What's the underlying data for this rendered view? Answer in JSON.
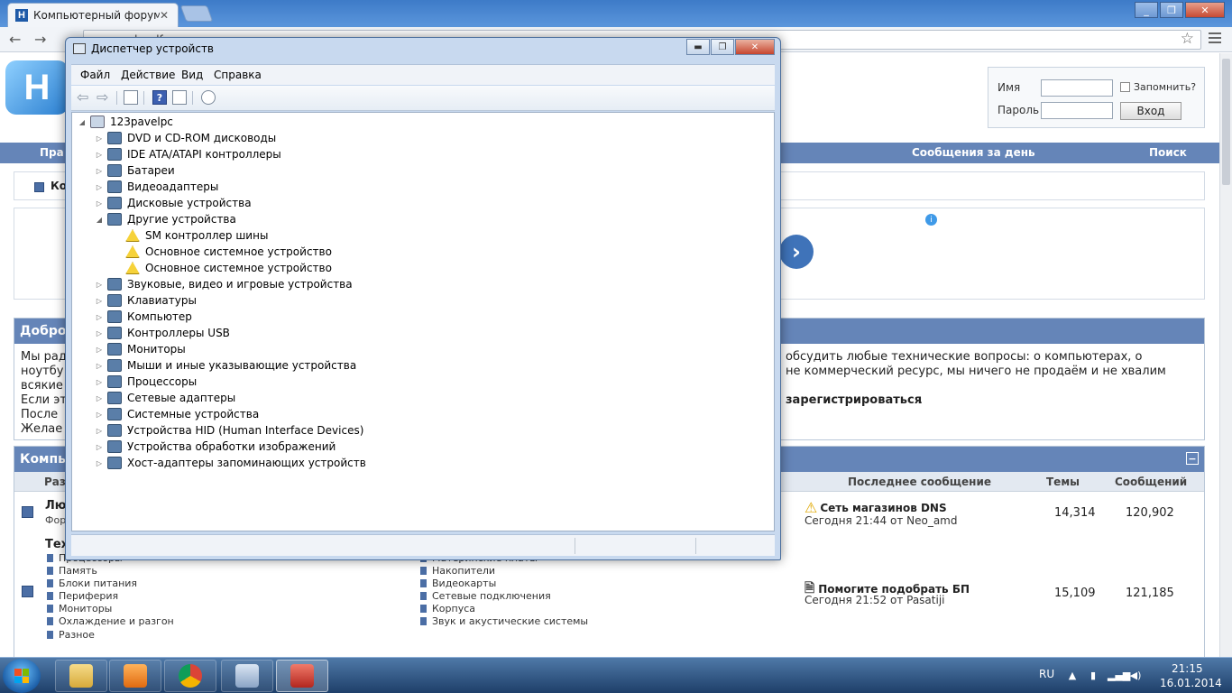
{
  "browser": {
    "tab_title": "Компьютерный форум",
    "tab_close": "✕",
    "favicon_letter": "H",
    "url": "www.hardforum.ru",
    "back_icon": "←",
    "forward_icon": "→",
    "star_icon": "☆",
    "window_buttons": [
      "_",
      "❐",
      "✕"
    ]
  },
  "site": {
    "logo_letter": "H",
    "login": {
      "name_label": "Имя",
      "password_label": "Пароль",
      "remember_label": "Запомнить?",
      "login_button": "Вход"
    },
    "navbar": {
      "left_partial": "Пра",
      "messages_today": "Сообщения за день",
      "search": "Поиск"
    },
    "breadcrumb_partial": "Ко",
    "ad_arrow": "›",
    "ad_info": "i",
    "welcome": {
      "title_partial": "Добро",
      "lines_left": [
        "Мы рад",
        "ноутбу",
        "всякие",
        "Если эт",
        "После",
        "Желае"
      ],
      "line1_right": "обсудить любые технические вопросы: о компьютерах, о",
      "line2_right": "не коммерческий ресурс, мы ничего не продаём и не хвалим",
      "line4_right_bold": "зарегистрироваться",
      "line4_right_end": "."
    },
    "forums": {
      "title_partial": "Компь",
      "collapse": "−",
      "columns": {
        "section_partial": "Раз",
        "last_post": "Последнее сообщение",
        "threads": "Темы",
        "posts": "Сообщений"
      },
      "rows": [
        {
          "title_partial": "Лю",
          "sub_partial": "Фор",
          "last_title": "Сеть магазинов DNS",
          "last_by": "Сегодня 21:44 от Neo_amd",
          "threads": "14,314",
          "posts": "120,902"
        },
        {
          "title_partial": "Тех",
          "last_title": "Помогите подобрать БП",
          "last_by": "Сегодня 21:52 от Pasatiji",
          "threads": "15,109",
          "posts": "121,185",
          "subforums_left": [
            "Процессоры",
            "Память",
            "Блоки питания",
            "Периферия",
            "Мониторы",
            "Охлаждение и разгон",
            "Разное"
          ],
          "subforums_right": [
            "Материнские платы",
            "Накопители",
            "Видеокарты",
            "Сетевые подключения",
            "Корпуса",
            "Звук и акустические системы"
          ]
        }
      ]
    }
  },
  "device_manager": {
    "title": "Диспетчер устройств",
    "window_buttons": [
      "▬",
      "❐",
      "✕"
    ],
    "menu": [
      "Файл",
      "Действие",
      "Вид",
      "Справка"
    ],
    "toolbar": {
      "back": "⇦",
      "forward": "⇨",
      "help": "?"
    },
    "root": "123pavelpc",
    "nodes": [
      {
        "label": "DVD и CD-ROM дисководы",
        "expander": "▷",
        "level": 1
      },
      {
        "label": "IDE ATA/ATAPI контроллеры",
        "expander": "▷",
        "level": 1
      },
      {
        "label": "Батареи",
        "expander": "▷",
        "level": 1
      },
      {
        "label": "Видеоадаптеры",
        "expander": "▷",
        "level": 1
      },
      {
        "label": "Дисковые устройства",
        "expander": "▷",
        "level": 1
      },
      {
        "label": "Другие устройства",
        "expander": "◢",
        "level": 1
      },
      {
        "label": "SM контроллер шины",
        "expander": "",
        "level": 2,
        "warning": true
      },
      {
        "label": "Основное системное устройство",
        "expander": "",
        "level": 2,
        "warning": true
      },
      {
        "label": "Основное системное устройство",
        "expander": "",
        "level": 2,
        "warning": true
      },
      {
        "label": "Звуковые, видео и игровые устройства",
        "expander": "▷",
        "level": 1
      },
      {
        "label": "Клавиатуры",
        "expander": "▷",
        "level": 1
      },
      {
        "label": "Компьютер",
        "expander": "▷",
        "level": 1
      },
      {
        "label": "Контроллеры USB",
        "expander": "▷",
        "level": 1
      },
      {
        "label": "Мониторы",
        "expander": "▷",
        "level": 1
      },
      {
        "label": "Мыши и иные указывающие устройства",
        "expander": "▷",
        "level": 1
      },
      {
        "label": "Процессоры",
        "expander": "▷",
        "level": 1
      },
      {
        "label": "Сетевые адаптеры",
        "expander": "▷",
        "level": 1
      },
      {
        "label": "Системные устройства",
        "expander": "▷",
        "level": 1
      },
      {
        "label": "Устройства HID (Human Interface Devices)",
        "expander": "▷",
        "level": 1
      },
      {
        "label": "Устройства обработки изображений",
        "expander": "▷",
        "level": 1
      },
      {
        "label": "Хост-адаптеры запоминающих устройств",
        "expander": "▷",
        "level": 1
      }
    ]
  },
  "taskbar": {
    "apps": [
      "explorer-icon",
      "media-player-icon",
      "chrome-icon",
      "device-manager-icon",
      "toolbox-icon"
    ],
    "language": "RU",
    "time": "21:15",
    "date": "16.01.2014",
    "tray_icons": [
      "▲",
      "▮",
      "▂▄▆",
      "◀)"
    ]
  }
}
